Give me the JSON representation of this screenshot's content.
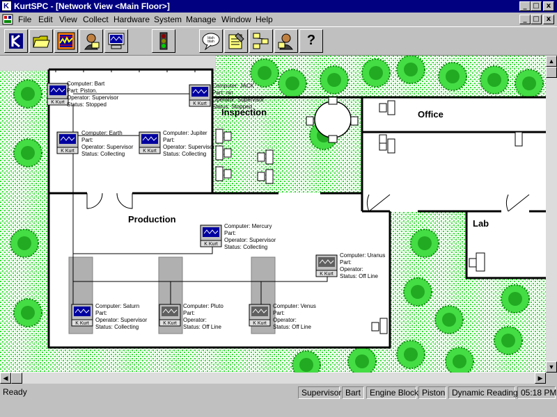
{
  "window": {
    "title": "KurtSPC - [Network View <Main Floor>]",
    "app_icon_letter": "K",
    "buttons": [
      "_",
      "□",
      "x"
    ],
    "doc_buttons": [
      "_",
      "□",
      "x"
    ]
  },
  "menu": [
    "File",
    "Edit",
    "View",
    "Collect",
    "Hardware",
    "System",
    "Manage",
    "Window",
    "Help"
  ],
  "toolbar": {
    "buttons": [
      {
        "name": "kurt-logo-button",
        "icon": "kurt-logo"
      },
      {
        "name": "open-folder-button",
        "icon": "folder-open-icon"
      },
      {
        "name": "control-chart-button",
        "icon": "chart-icon"
      },
      {
        "name": "operator-button",
        "icon": "person-icon"
      },
      {
        "name": "network-view-button",
        "icon": "monitor-icon"
      },
      {
        "name": "traffic-light-button",
        "icon": "traffic-light-icon"
      },
      {
        "name": "message-button",
        "icon": "speech-bubble-icon",
        "text": "blah blah"
      },
      {
        "name": "notes-button",
        "icon": "notepad-icon"
      },
      {
        "name": "hierarchy-button",
        "icon": "hierarchy-icon"
      },
      {
        "name": "help-person-button",
        "icon": "person-help-icon"
      },
      {
        "name": "help-button",
        "icon": "question-icon",
        "text": "?"
      }
    ]
  },
  "rooms": {
    "inspection": "Inspection",
    "office": "Office",
    "production": "Production",
    "lab": "Lab"
  },
  "computers": [
    {
      "id": "bart",
      "lines": [
        "Computer: Bart",
        "Part: Piston.",
        "Operator: Supervisor",
        "Status: Stopped"
      ],
      "status": "stopped"
    },
    {
      "id": "jack",
      "lines": [
        "Computer: JACK",
        "Part: nin",
        "Operator: Supervisor",
        "Status: Stopped"
      ],
      "status": "stopped"
    },
    {
      "id": "earth",
      "lines": [
        "Computer: Earth",
        "Part:",
        "Operator: Supervisor",
        "Status: Collecting"
      ],
      "status": "collecting"
    },
    {
      "id": "jupiter",
      "lines": [
        "Computer: Jupiter",
        "Part:",
        "Operator: Supervisor",
        "Status: Collecting"
      ],
      "status": "collecting"
    },
    {
      "id": "mercury",
      "lines": [
        "Computer: Mercury",
        "Part:",
        "Operator: Supervisor",
        "Status: Collecting"
      ],
      "status": "collecting"
    },
    {
      "id": "uranus",
      "lines": [
        "Computer: Uranus",
        "Part:",
        "Operator:",
        "Status: Off Line"
      ],
      "status": "offline"
    },
    {
      "id": "saturn",
      "lines": [
        "Computer: Saturn",
        "Part:",
        "Operator: Supervisor",
        "Status: Collecting"
      ],
      "status": "collecting"
    },
    {
      "id": "pluto",
      "lines": [
        "Computer: Pluto",
        "Part:",
        "Operator:",
        "Status: Off Line"
      ],
      "status": "offline"
    },
    {
      "id": "venus",
      "lines": [
        "Computer: Venus",
        "Part:",
        "Operator:",
        "Status: Off Line"
      ],
      "status": "offline"
    }
  ],
  "kurt_label": "K Kurt",
  "statusbar": {
    "message": "Ready",
    "panels": [
      "Supervisor",
      "Bart",
      "Engine Block",
      "Piston",
      "Dynamic Reading",
      "05:18 PM"
    ]
  },
  "colors": {
    "titlebar": "#000080",
    "grass": "#33dd33",
    "screen_active": "#0000a0",
    "screen_offline": "#606060",
    "wall": "#000000"
  }
}
